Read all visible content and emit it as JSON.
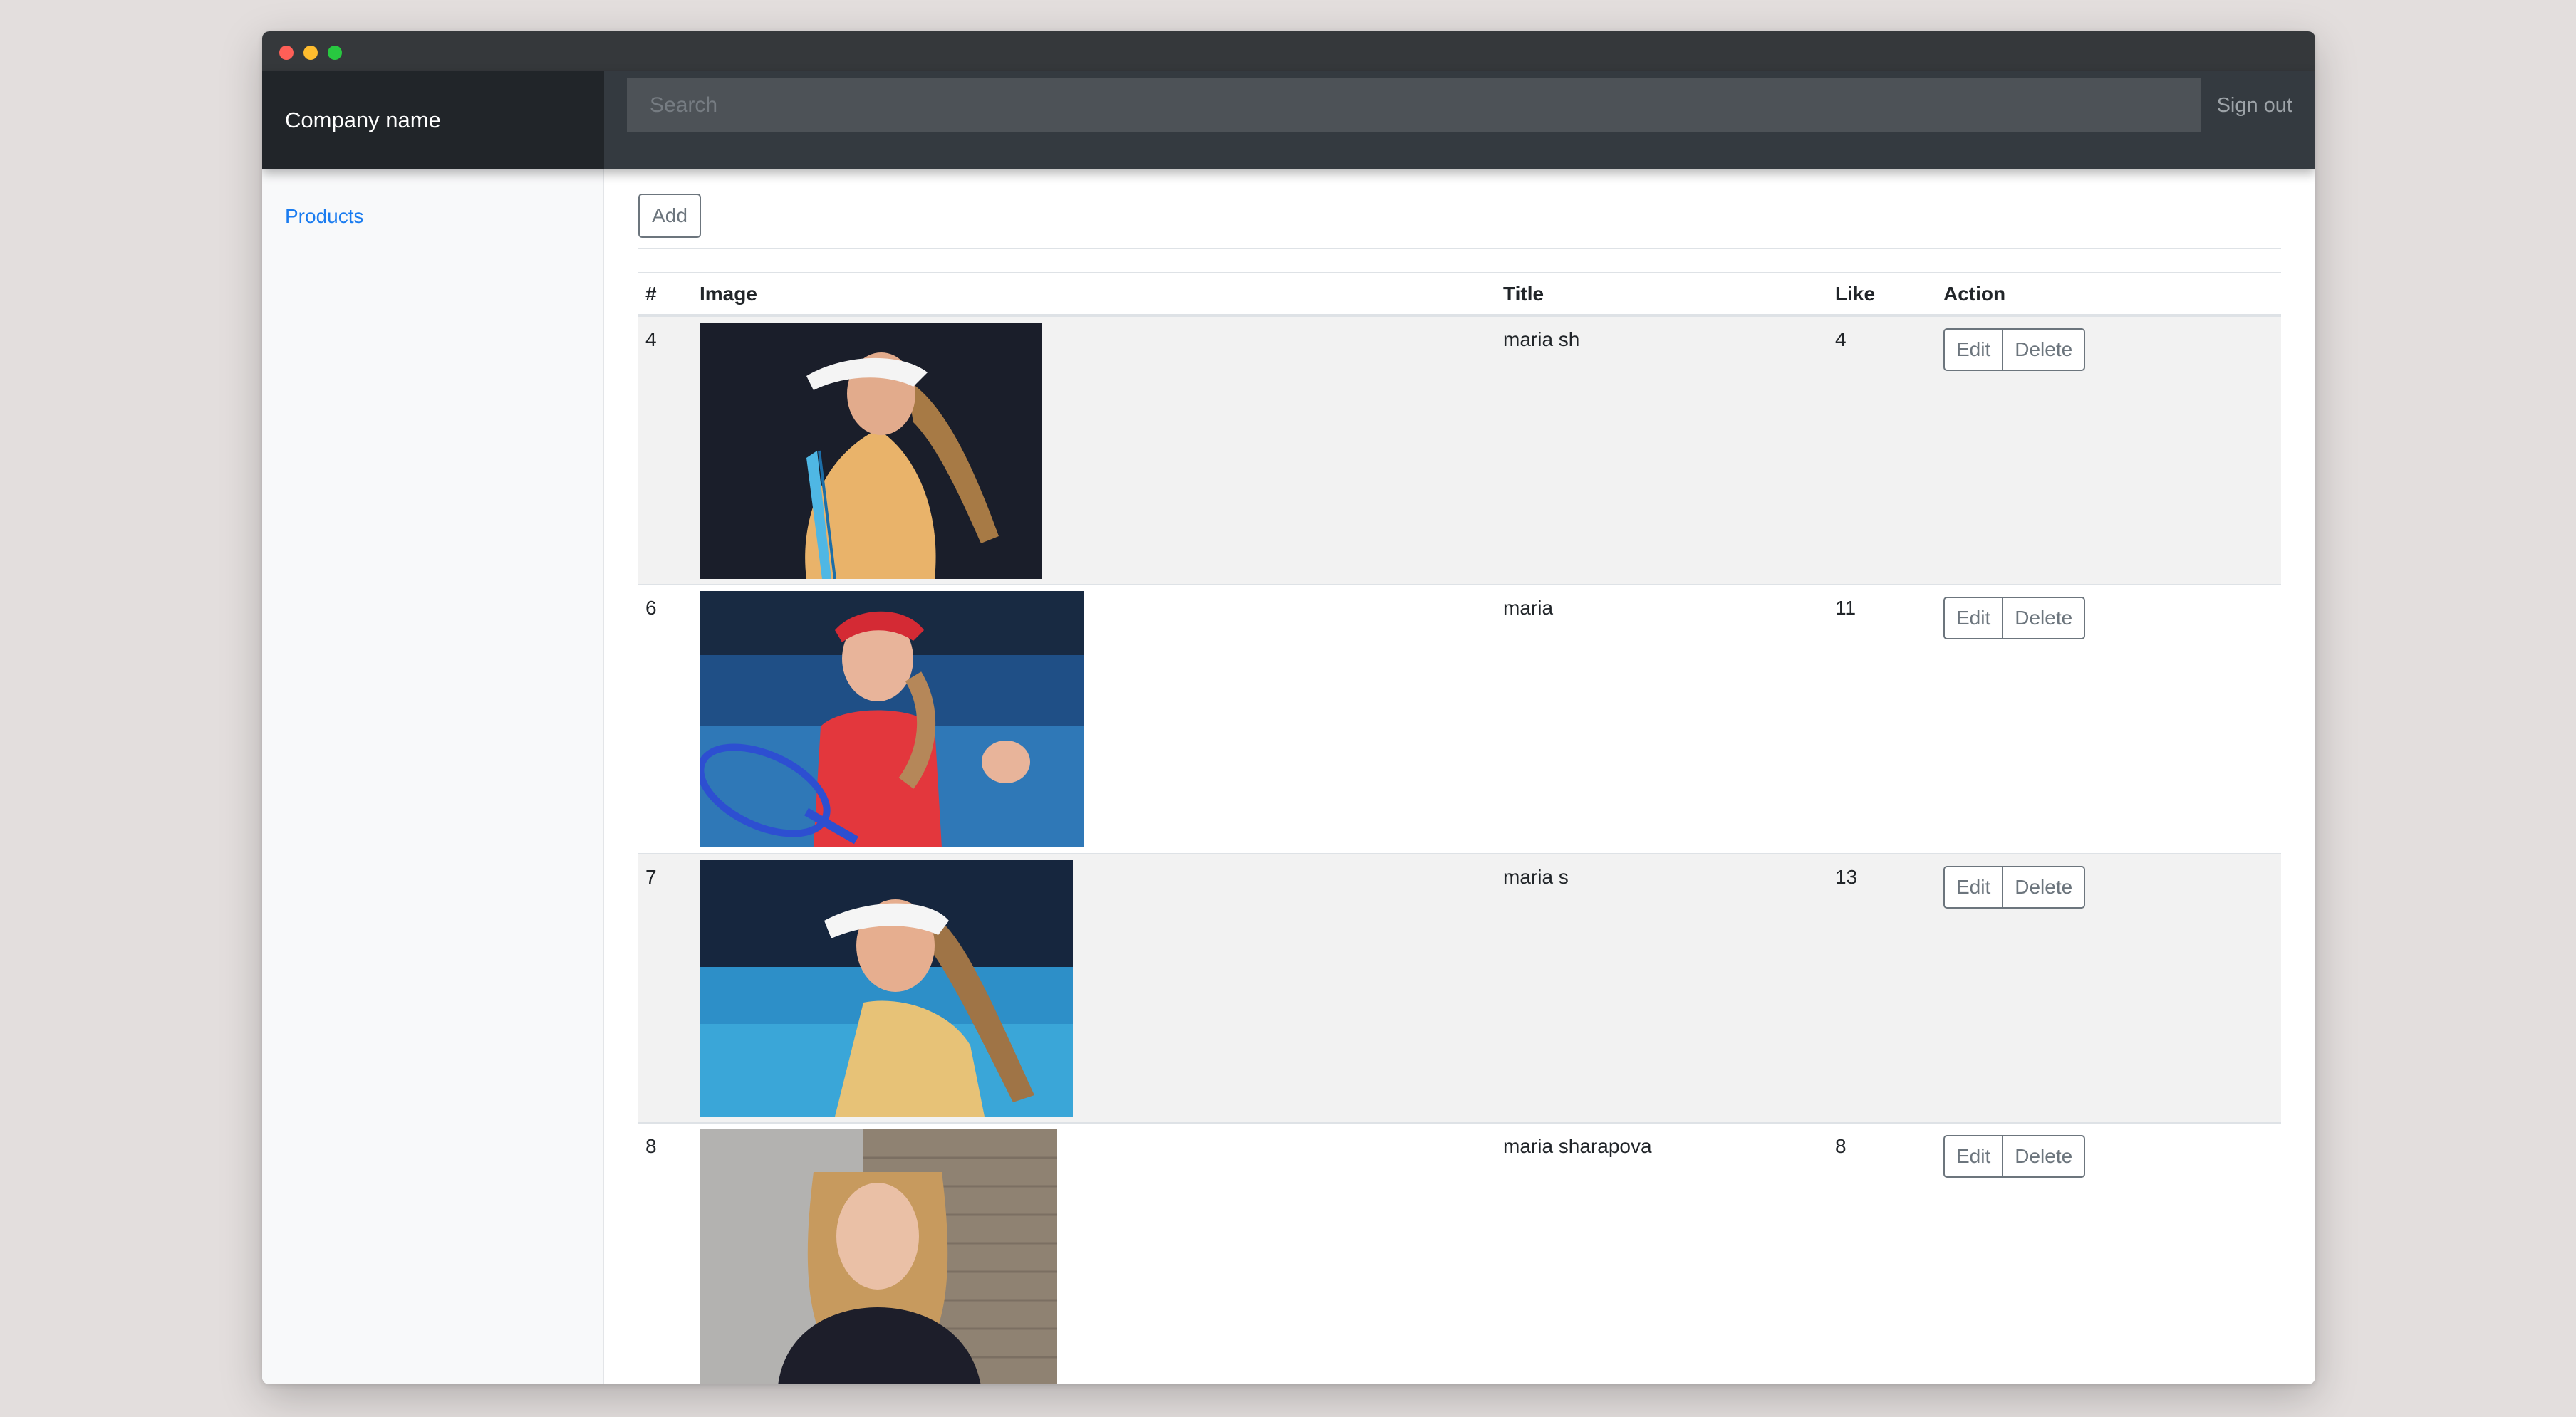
{
  "window": {
    "controls": [
      "close",
      "minimize",
      "maximize"
    ]
  },
  "navbar": {
    "brand": "Company name",
    "search_placeholder": "Search",
    "signout_label": "Sign out"
  },
  "sidebar": {
    "items": [
      {
        "label": "Products",
        "active": true
      }
    ]
  },
  "main": {
    "add_label": "Add",
    "table": {
      "headers": [
        "#",
        "Image",
        "Title",
        "Like",
        "Action"
      ],
      "rows": [
        {
          "id": "4",
          "title": "maria sh",
          "like": "4",
          "image_desc": "woman in white visor and yellow top holding racket, dark background"
        },
        {
          "id": "6",
          "title": "maria",
          "like": "11",
          "image_desc": "woman in red cap and red top celebrating with racket, blue background"
        },
        {
          "id": "7",
          "title": "maria s",
          "like": "13",
          "image_desc": "woman in white visor and yellow top, blue court background"
        },
        {
          "id": "8",
          "title": "maria sharapova",
          "like": "8",
          "image_desc": "woman with long blonde hair in dark sweater, indoor background"
        }
      ],
      "actions": {
        "edit": "Edit",
        "delete": "Delete"
      }
    }
  },
  "colors": {
    "navbar": "#343a40",
    "brand_bg": "#212529",
    "link": "#1a7cf0",
    "button_border": "#6c757d",
    "striped_row": "#f2f2f2"
  }
}
